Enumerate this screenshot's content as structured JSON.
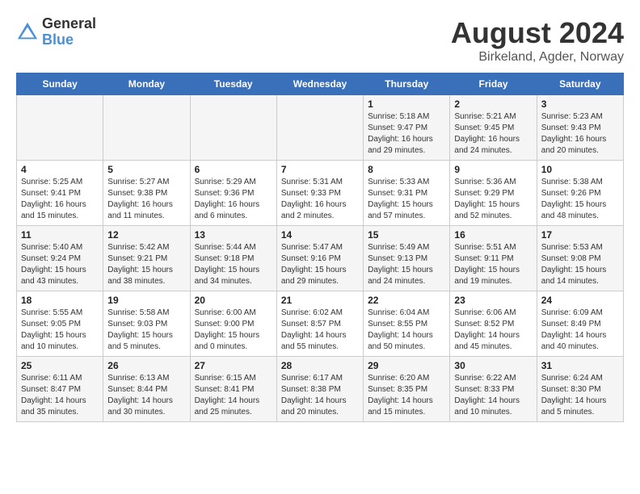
{
  "header": {
    "logo": {
      "line1": "General",
      "line2": "Blue"
    },
    "title": "August 2024",
    "subtitle": "Birkeland, Agder, Norway"
  },
  "calendar": {
    "days_of_week": [
      "Sunday",
      "Monday",
      "Tuesday",
      "Wednesday",
      "Thursday",
      "Friday",
      "Saturday"
    ],
    "weeks": [
      [
        {
          "day": "",
          "info": ""
        },
        {
          "day": "",
          "info": ""
        },
        {
          "day": "",
          "info": ""
        },
        {
          "day": "",
          "info": ""
        },
        {
          "day": "1",
          "info": "Sunrise: 5:18 AM\nSunset: 9:47 PM\nDaylight: 16 hours\nand 29 minutes."
        },
        {
          "day": "2",
          "info": "Sunrise: 5:21 AM\nSunset: 9:45 PM\nDaylight: 16 hours\nand 24 minutes."
        },
        {
          "day": "3",
          "info": "Sunrise: 5:23 AM\nSunset: 9:43 PM\nDaylight: 16 hours\nand 20 minutes."
        }
      ],
      [
        {
          "day": "4",
          "info": "Sunrise: 5:25 AM\nSunset: 9:41 PM\nDaylight: 16 hours\nand 15 minutes."
        },
        {
          "day": "5",
          "info": "Sunrise: 5:27 AM\nSunset: 9:38 PM\nDaylight: 16 hours\nand 11 minutes."
        },
        {
          "day": "6",
          "info": "Sunrise: 5:29 AM\nSunset: 9:36 PM\nDaylight: 16 hours\nand 6 minutes."
        },
        {
          "day": "7",
          "info": "Sunrise: 5:31 AM\nSunset: 9:33 PM\nDaylight: 16 hours\nand 2 minutes."
        },
        {
          "day": "8",
          "info": "Sunrise: 5:33 AM\nSunset: 9:31 PM\nDaylight: 15 hours\nand 57 minutes."
        },
        {
          "day": "9",
          "info": "Sunrise: 5:36 AM\nSunset: 9:29 PM\nDaylight: 15 hours\nand 52 minutes."
        },
        {
          "day": "10",
          "info": "Sunrise: 5:38 AM\nSunset: 9:26 PM\nDaylight: 15 hours\nand 48 minutes."
        }
      ],
      [
        {
          "day": "11",
          "info": "Sunrise: 5:40 AM\nSunset: 9:24 PM\nDaylight: 15 hours\nand 43 minutes."
        },
        {
          "day": "12",
          "info": "Sunrise: 5:42 AM\nSunset: 9:21 PM\nDaylight: 15 hours\nand 38 minutes."
        },
        {
          "day": "13",
          "info": "Sunrise: 5:44 AM\nSunset: 9:18 PM\nDaylight: 15 hours\nand 34 minutes."
        },
        {
          "day": "14",
          "info": "Sunrise: 5:47 AM\nSunset: 9:16 PM\nDaylight: 15 hours\nand 29 minutes."
        },
        {
          "day": "15",
          "info": "Sunrise: 5:49 AM\nSunset: 9:13 PM\nDaylight: 15 hours\nand 24 minutes."
        },
        {
          "day": "16",
          "info": "Sunrise: 5:51 AM\nSunset: 9:11 PM\nDaylight: 15 hours\nand 19 minutes."
        },
        {
          "day": "17",
          "info": "Sunrise: 5:53 AM\nSunset: 9:08 PM\nDaylight: 15 hours\nand 14 minutes."
        }
      ],
      [
        {
          "day": "18",
          "info": "Sunrise: 5:55 AM\nSunset: 9:05 PM\nDaylight: 15 hours\nand 10 minutes."
        },
        {
          "day": "19",
          "info": "Sunrise: 5:58 AM\nSunset: 9:03 PM\nDaylight: 15 hours\nand 5 minutes."
        },
        {
          "day": "20",
          "info": "Sunrise: 6:00 AM\nSunset: 9:00 PM\nDaylight: 15 hours\nand 0 minutes."
        },
        {
          "day": "21",
          "info": "Sunrise: 6:02 AM\nSunset: 8:57 PM\nDaylight: 14 hours\nand 55 minutes."
        },
        {
          "day": "22",
          "info": "Sunrise: 6:04 AM\nSunset: 8:55 PM\nDaylight: 14 hours\nand 50 minutes."
        },
        {
          "day": "23",
          "info": "Sunrise: 6:06 AM\nSunset: 8:52 PM\nDaylight: 14 hours\nand 45 minutes."
        },
        {
          "day": "24",
          "info": "Sunrise: 6:09 AM\nSunset: 8:49 PM\nDaylight: 14 hours\nand 40 minutes."
        }
      ],
      [
        {
          "day": "25",
          "info": "Sunrise: 6:11 AM\nSunset: 8:47 PM\nDaylight: 14 hours\nand 35 minutes."
        },
        {
          "day": "26",
          "info": "Sunrise: 6:13 AM\nSunset: 8:44 PM\nDaylight: 14 hours\nand 30 minutes."
        },
        {
          "day": "27",
          "info": "Sunrise: 6:15 AM\nSunset: 8:41 PM\nDaylight: 14 hours\nand 25 minutes."
        },
        {
          "day": "28",
          "info": "Sunrise: 6:17 AM\nSunset: 8:38 PM\nDaylight: 14 hours\nand 20 minutes."
        },
        {
          "day": "29",
          "info": "Sunrise: 6:20 AM\nSunset: 8:35 PM\nDaylight: 14 hours\nand 15 minutes."
        },
        {
          "day": "30",
          "info": "Sunrise: 6:22 AM\nSunset: 8:33 PM\nDaylight: 14 hours\nand 10 minutes."
        },
        {
          "day": "31",
          "info": "Sunrise: 6:24 AM\nSunset: 8:30 PM\nDaylight: 14 hours\nand 5 minutes."
        }
      ]
    ]
  }
}
